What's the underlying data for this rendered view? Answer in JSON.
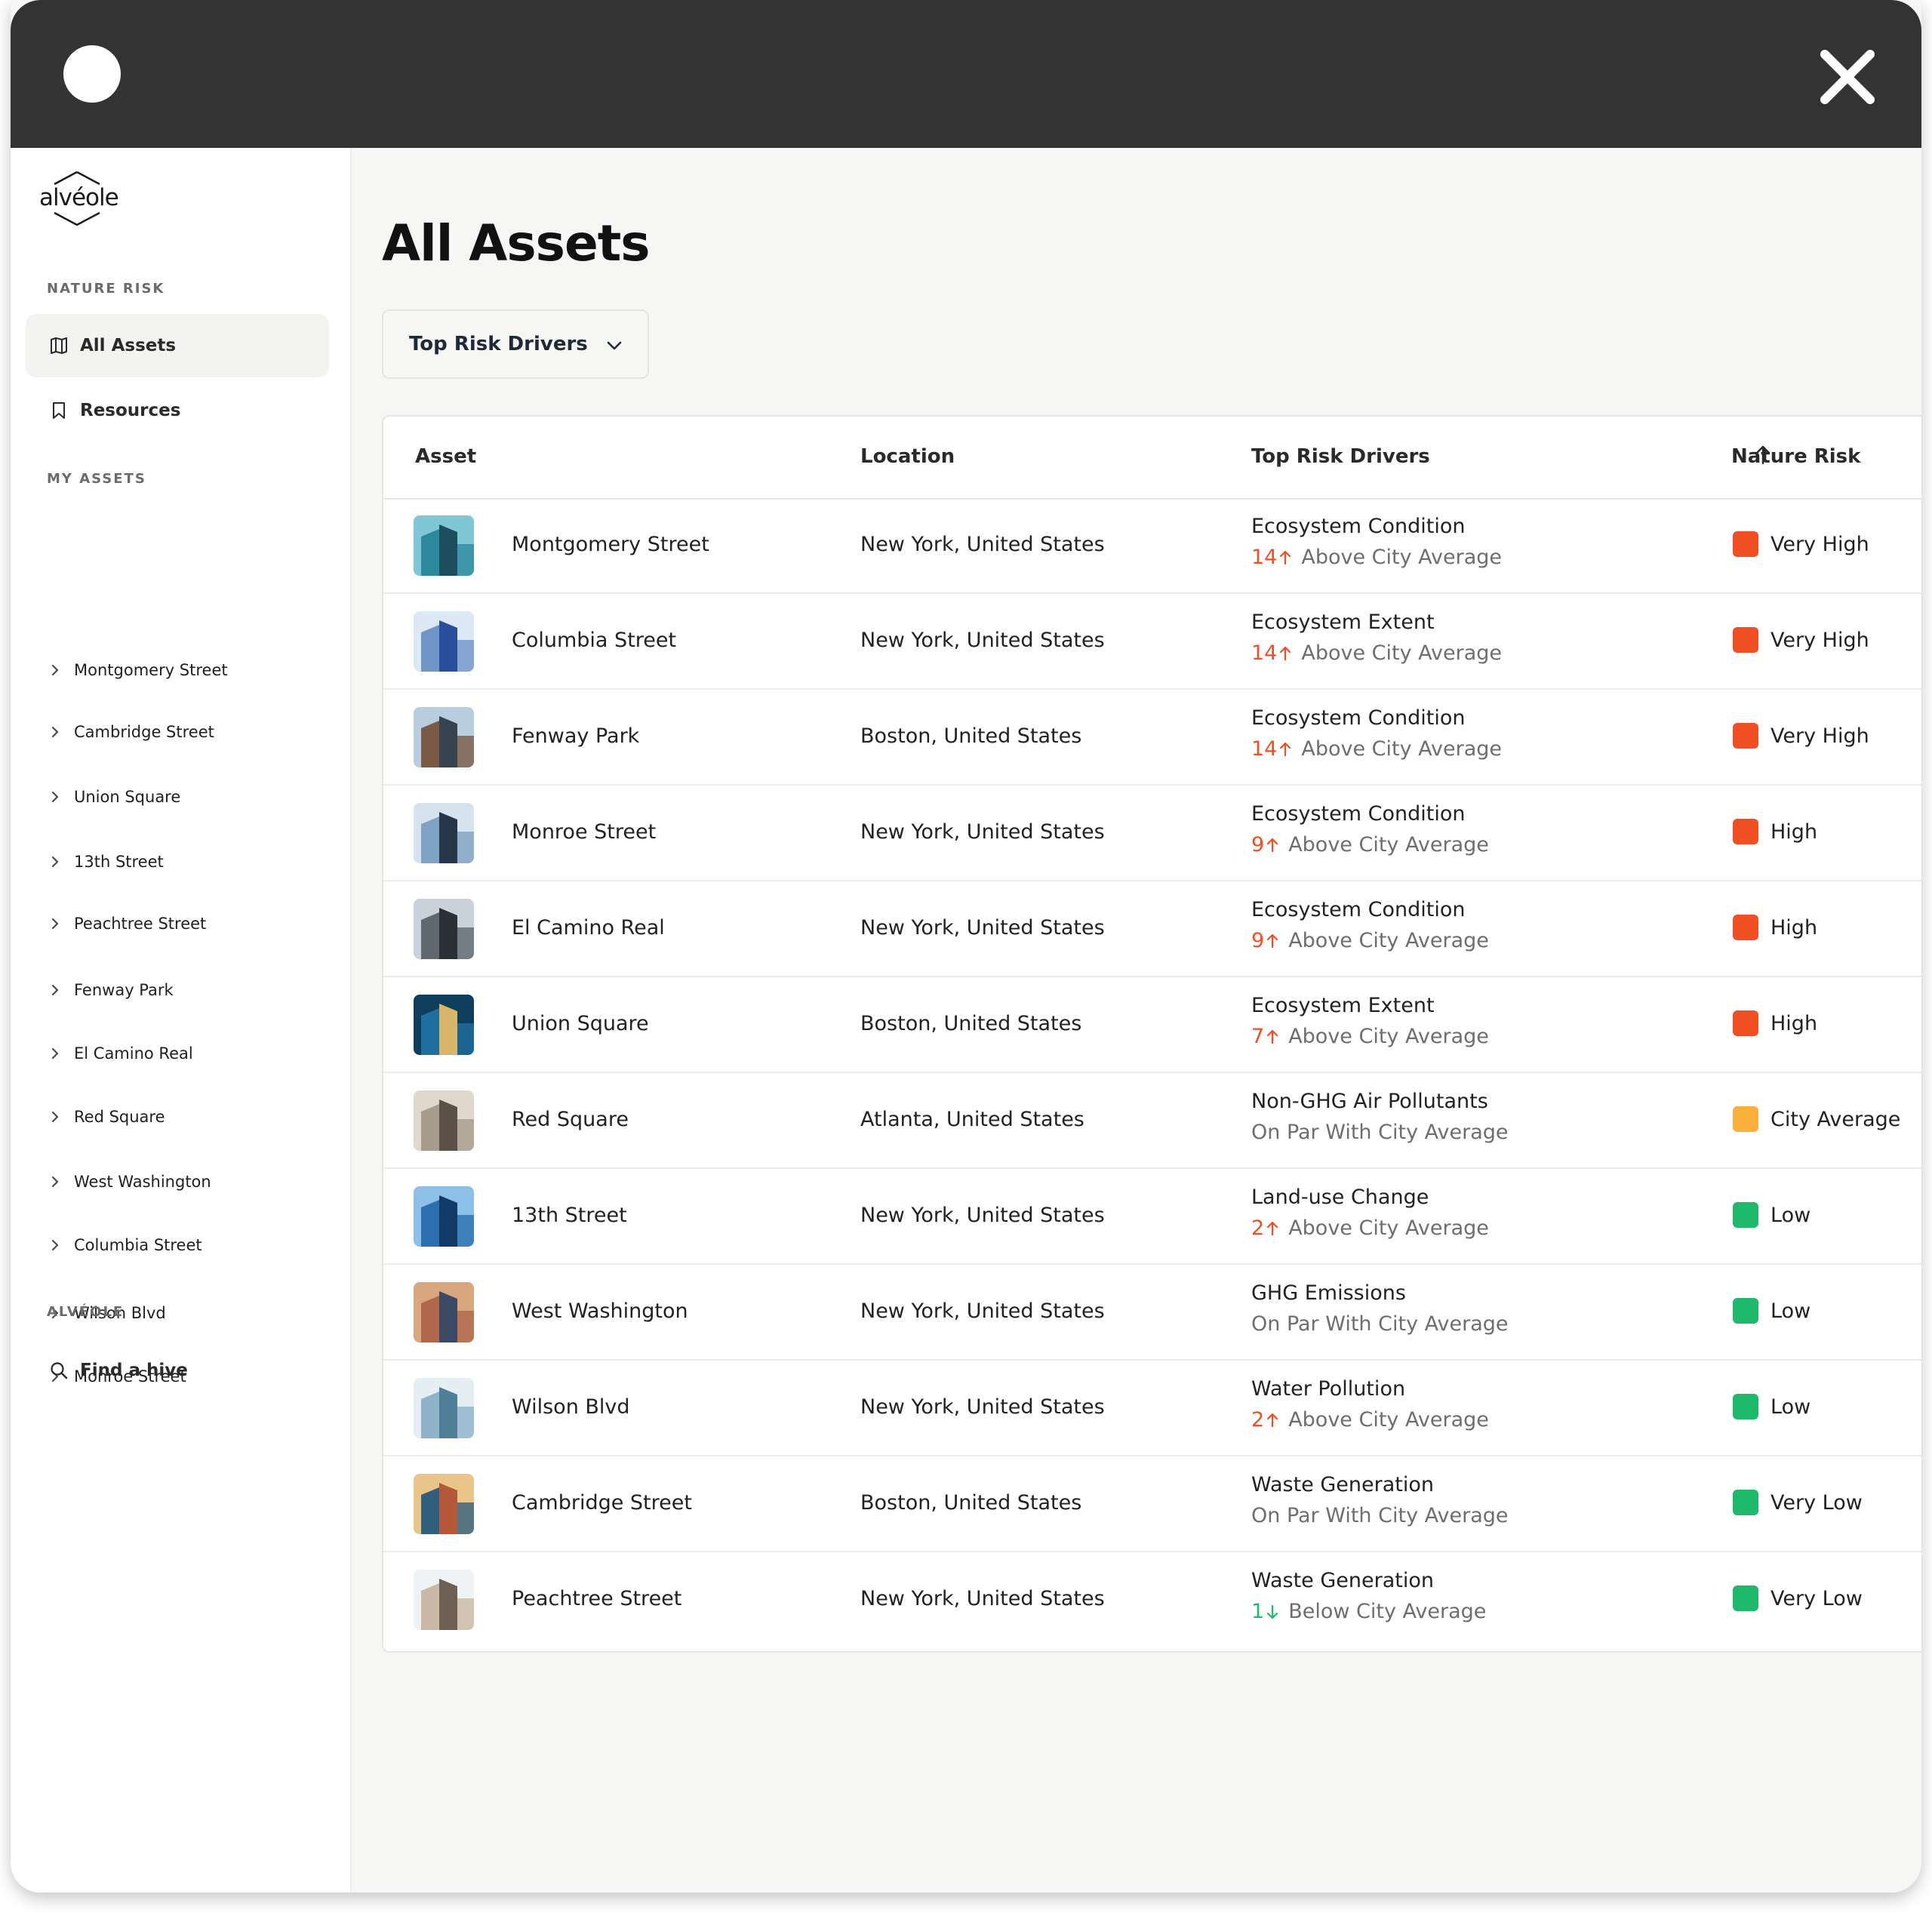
{
  "logo": {
    "text": "alvéole"
  },
  "sidebar": {
    "sections": {
      "nature_risk": "NATURE RISK",
      "my_assets": "MY ASSETS",
      "alveole": "ALVÉOLE"
    },
    "nav": [
      {
        "label": "All Assets",
        "icon": "map-icon",
        "active": true
      },
      {
        "label": "Resources",
        "icon": "bookmark-icon",
        "active": false
      }
    ],
    "assets": [
      "Montgomery Street",
      "Cambridge Street",
      "Union Square",
      "13th Street",
      "Peachtree Street",
      "Fenway Park",
      "El Camino Real",
      "Red Square",
      "West Washington",
      "Columbia Street",
      "Wilson Blvd",
      "Monroe Street"
    ],
    "find_hive": {
      "label": "Find a hive",
      "icon": "search-icon"
    }
  },
  "main": {
    "title": "All Assets",
    "dropdown": {
      "selected": "Top Risk Drivers"
    },
    "table": {
      "headers": {
        "asset": "Asset",
        "location": "Location",
        "drivers": "Top Risk Drivers",
        "risk": "Nature Risk"
      },
      "rows": [
        {
          "asset": "Montgomery Street",
          "location": "New York, United States",
          "driver": "Ecosystem Condition",
          "num": "14",
          "dir": "up",
          "cmp": "Above City Average",
          "risk": "Very High",
          "risk_color": "#f04e23"
        },
        {
          "asset": "Columbia Street",
          "location": "New York, United States",
          "driver": "Ecosystem Extent",
          "num": "14",
          "dir": "up",
          "cmp": "Above City Average",
          "risk": "Very High",
          "risk_color": "#f04e23"
        },
        {
          "asset": "Fenway Park",
          "location": "Boston, United States",
          "driver": "Ecosystem Condition",
          "num": "14",
          "dir": "up",
          "cmp": "Above City Average",
          "risk": "Very High",
          "risk_color": "#f04e23"
        },
        {
          "asset": "Monroe Street",
          "location": "New York, United States",
          "driver": "Ecosystem Condition",
          "num": "9",
          "dir": "up",
          "cmp": "Above City Average",
          "risk": "High",
          "risk_color": "#f04e23"
        },
        {
          "asset": "El Camino Real",
          "location": "New York, United States",
          "driver": "Ecosystem Condition",
          "num": "9",
          "dir": "up",
          "cmp": "Above City Average",
          "risk": "High",
          "risk_color": "#f04e23"
        },
        {
          "asset": "Union Square",
          "location": "Boston, United States",
          "driver": "Ecosystem Extent",
          "num": "7",
          "dir": "up",
          "cmp": "Above City Average",
          "risk": "High",
          "risk_color": "#f04e23"
        },
        {
          "asset": "Red Square",
          "location": "Atlanta, United States",
          "driver": "Non-GHG Air Pollutants",
          "num": "",
          "dir": "",
          "cmp": "On Par With City Average",
          "risk": "City Average",
          "risk_color": "#fbb03b"
        },
        {
          "asset": "13th Street",
          "location": "New York, United States",
          "driver": "Land-use Change",
          "num": "2",
          "dir": "up",
          "cmp": "Above City Average",
          "risk": "Low",
          "risk_color": "#1fb96b"
        },
        {
          "asset": "West Washington",
          "location": "New York, United States",
          "driver": "GHG Emissions",
          "num": "",
          "dir": "",
          "cmp": "On Par With City Average",
          "risk": "Low",
          "risk_color": "#1fb96b"
        },
        {
          "asset": "Wilson Blvd",
          "location": "New York, United States",
          "driver": "Water Pollution",
          "num": "2",
          "dir": "up",
          "cmp": "Above City Average",
          "risk": "Low",
          "risk_color": "#1fb96b"
        },
        {
          "asset": "Cambridge Street",
          "location": "Boston, United States",
          "driver": "Waste Generation",
          "num": "",
          "dir": "",
          "cmp": "On Par With City Average",
          "risk": "Very Low",
          "risk_color": "#1fb96b"
        },
        {
          "asset": "Peachtree Street",
          "location": "New York, United States",
          "driver": "Waste Generation",
          "num": "1",
          "dir": "down",
          "cmp": "Below City Average",
          "risk": "Very Low",
          "risk_color": "#1fb96b"
        }
      ]
    }
  },
  "colors": {
    "up": "#f04e23",
    "down": "#1fb96b"
  }
}
